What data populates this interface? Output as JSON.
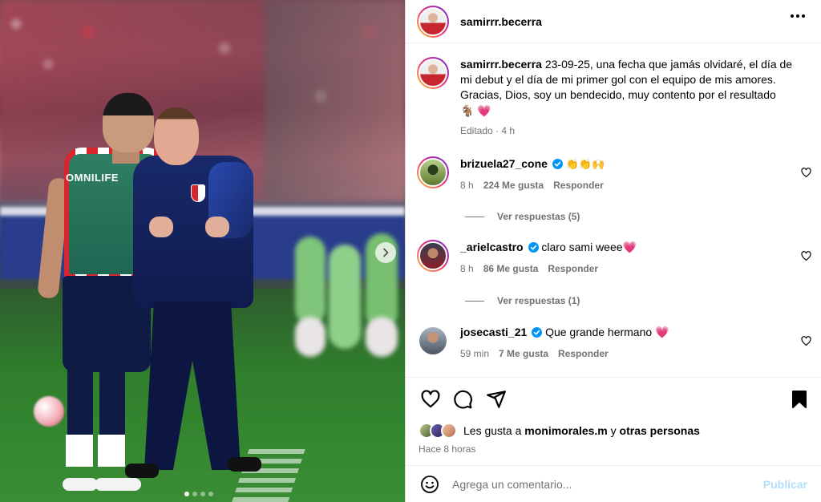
{
  "post": {
    "author": "samirrr.becerra",
    "caption_author": "samirrr.becerra",
    "caption_text": "23-09-25, una fecha que jamás olvidaré, el día de mi debut y el día de mi primer gol con el equipo de mis amores. Gracias, Dios, soy un bendecido, muy contento por el resultado",
    "caption_emojis": "🐐 💗",
    "caption_meta": "Editado · 4 h",
    "image_jersey_text": "OMNILIFE",
    "carousel_dots": 4,
    "carousel_active": 1
  },
  "comments": [
    {
      "user": "brizuela27_cone",
      "verified": true,
      "text": "👏👏🙌",
      "time": "8 h",
      "likes": "224 Me gusta",
      "reply": "Responder",
      "replies_label": "Ver respuestas (5)"
    },
    {
      "user": "_arielcastro",
      "verified": true,
      "text": "claro sami weee💗",
      "time": "8 h",
      "likes": "86 Me gusta",
      "reply": "Responder",
      "replies_label": "Ver respuestas (1)"
    },
    {
      "user": "josecasti_21",
      "verified": true,
      "text": "Que grande hermano 💗",
      "time": "59 min",
      "likes": "7 Me gusta",
      "reply": "Responder"
    }
  ],
  "likes": {
    "prefix": "Les gusta a",
    "user": "monimorales.m",
    "connector": "y",
    "others": "otras personas"
  },
  "posted_ago": "Hace 8 horas",
  "add_comment": {
    "placeholder": "Agrega un comentario...",
    "publish_label": "Publicar"
  },
  "icons": {
    "like": "heart-icon",
    "comment": "comment-bubble-icon",
    "share": "send-icon",
    "save": "bookmark-icon",
    "emoji": "smiley-icon",
    "more": "more-options-icon",
    "next": "chevron-right-icon"
  },
  "colors": {
    "verified_blue": "#0095f6",
    "publish_disabled": "#b2dffc",
    "secondary_text": "#737373"
  }
}
